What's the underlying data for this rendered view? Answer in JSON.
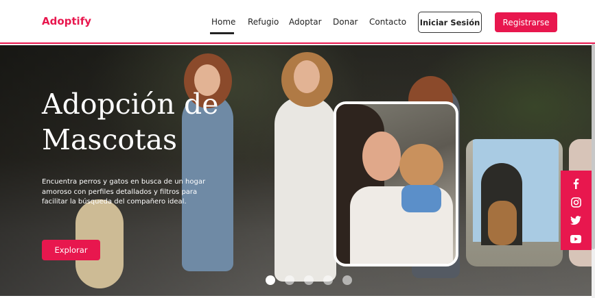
{
  "brand": {
    "logo_text": "Adoptify",
    "accent_color": "#e8174e"
  },
  "nav": {
    "links": [
      {
        "label": "Home",
        "active": true
      },
      {
        "label": "Refugio",
        "active": false
      },
      {
        "label": "Adoptar",
        "active": false
      },
      {
        "label": "Donar",
        "active": false
      },
      {
        "label": "Contacto",
        "active": false
      }
    ],
    "login_label": "Iniciar Sesión",
    "register_label": "Registrarse"
  },
  "hero": {
    "title_line1": "Adopción de",
    "title_line2": "Mascotas",
    "description": "Encuentra perros y gatos en busca de un hogar amoroso con perfiles detallados y filtros para facilitar la búsqueda del compañero ideal.",
    "cta_label": "Explorar",
    "carousel": {
      "slide_count": 5,
      "active_index": 0
    }
  },
  "social": [
    {
      "icon": "facebook-icon"
    },
    {
      "icon": "instagram-icon"
    },
    {
      "icon": "twitter-icon"
    },
    {
      "icon": "youtube-icon"
    }
  ]
}
